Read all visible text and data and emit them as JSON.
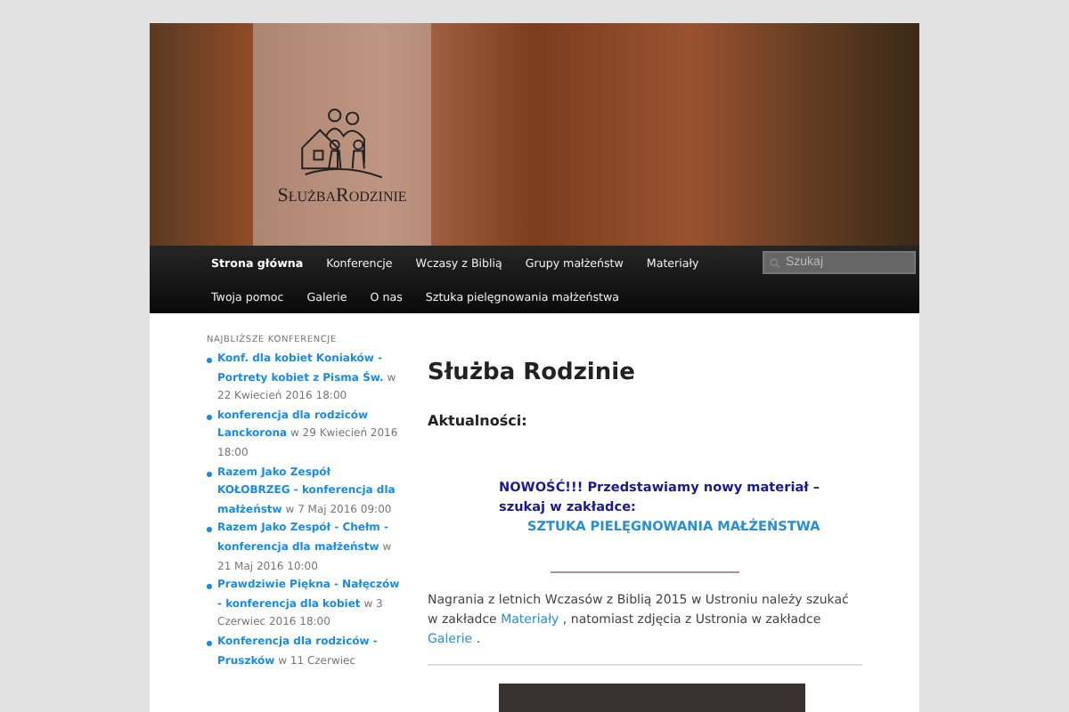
{
  "header": {
    "logo_text": "SłużbaRodzinie"
  },
  "nav": {
    "items": [
      {
        "label": "Strona główna",
        "selected": true
      },
      {
        "label": "Konferencje",
        "selected": false
      },
      {
        "label": "Wczasy z Biblią",
        "selected": false
      },
      {
        "label": "Grupy małżeństw",
        "selected": false
      },
      {
        "label": "Materiały",
        "selected": false
      },
      {
        "label": "Twoja pomoc",
        "selected": false
      },
      {
        "label": "Galerie",
        "selected": false
      },
      {
        "label": "O nas",
        "selected": false
      },
      {
        "label": "Sztuka pielęgnowania małżeństwa",
        "selected": false
      }
    ],
    "search": {
      "placeholder": "Szukaj"
    }
  },
  "sidebar": {
    "title": "NAJBLIŻSZE KONFERENCJE",
    "items": [
      {
        "title": "Konf. dla kobiet Koniaków - Portrety kobiet z Pisma Św.",
        "meta": "w 22 Kwiecień 2016 18:00"
      },
      {
        "title": "konferencja dla rodziców Lanckorona",
        "meta": "w 29 Kwiecień 2016 18:00"
      },
      {
        "title": "Razem Jako Zespół KOŁOBRZEG - konferencja dla małżeństw",
        "meta": "w 7 Maj 2016 09:00"
      },
      {
        "title": "Razem Jako Zespół - Chełm - konferencja dla małżeństw",
        "meta": "w 21 Maj 2016 10:00"
      },
      {
        "title": "Prawdziwie Piękna - Nałęczów - konferencja dla kobiet",
        "meta": "w 3 Czerwiec 2016 18:00"
      },
      {
        "title": "Konferencja dla rodziców - Pruszków",
        "meta": "w 11 Czerwiec"
      }
    ]
  },
  "main": {
    "title": "Służba Rodzinie",
    "subtitle": "Aktualności:",
    "notice": {
      "text": "NOWOŚĆ!!!  Przedstawiamy nowy materiał – szukaj w zakładce:",
      "link": "SZTUKA PIELĘGNOWANIA MAŁŻEŃSTWA"
    },
    "paragraph": [
      {
        "kind": "text",
        "text": "Nagrania z letnich Wczasów z Biblią  2015 w Ustroniu należy szukać w zakładce "
      },
      {
        "kind": "link",
        "text": "Materiały"
      },
      {
        "kind": "text",
        "text": " , natomiast zdjęcia z Ustronia w zakładce "
      },
      {
        "kind": "link",
        "text": "Galerie"
      },
      {
        "kind": "text",
        "text": " ."
      }
    ]
  }
}
